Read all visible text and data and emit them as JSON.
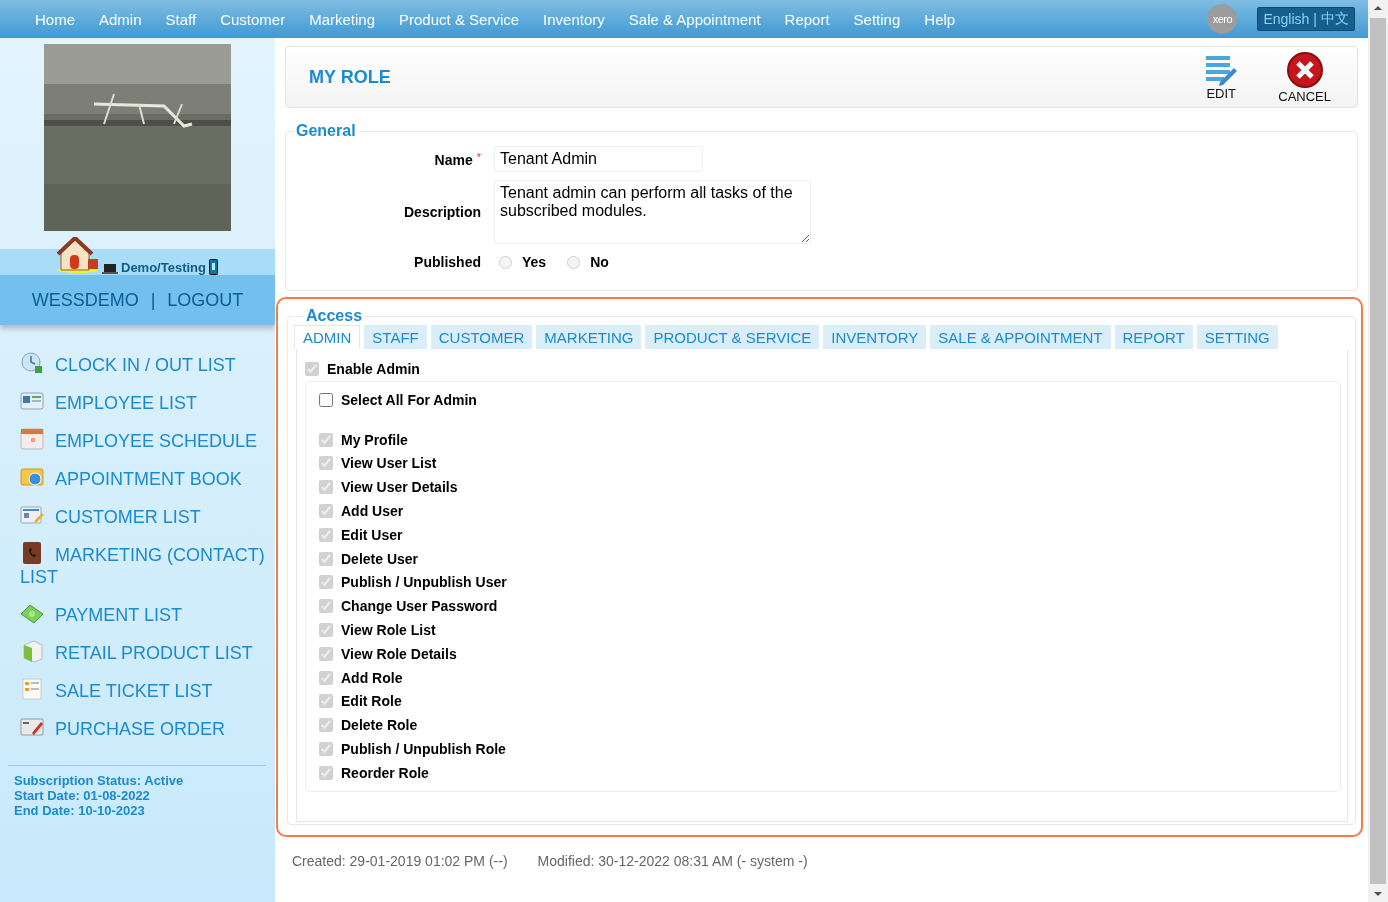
{
  "nav": {
    "items": [
      "Home",
      "Admin",
      "Staff",
      "Customer",
      "Marketing",
      "Product & Service",
      "Inventory",
      "Sale & Appointment",
      "Report",
      "Setting",
      "Help"
    ],
    "logo": "xero",
    "language": {
      "items": [
        "English",
        "中文"
      ],
      "separator": "|"
    }
  },
  "sidebar": {
    "site": "Demo/Testing",
    "user": "WESSDEMO",
    "separator": "|",
    "logout": "LOGOUT",
    "menu": [
      {
        "label": "CLOCK IN / OUT LIST"
      },
      {
        "label": "EMPLOYEE LIST"
      },
      {
        "label": "EMPLOYEE SCHEDULE"
      },
      {
        "label": "APPOINTMENT BOOK"
      },
      {
        "label": "CUSTOMER LIST"
      },
      {
        "label": "MARKETING (CONTACT) LIST"
      },
      {
        "label": "PAYMENT LIST"
      },
      {
        "label": "RETAIL PRODUCT LIST"
      },
      {
        "label": "SALE TICKET LIST"
      },
      {
        "label": "PURCHASE ORDER"
      }
    ],
    "subscription": [
      "Subscription Status: Active",
      "Start Date: 01-08-2022",
      "End Date: 10-10-2023"
    ]
  },
  "header": {
    "title": "MY ROLE",
    "actions": [
      {
        "kind": "edit",
        "label": "EDIT"
      },
      {
        "kind": "cancel",
        "label": "CANCEL"
      }
    ]
  },
  "general": {
    "legend": "General",
    "name": {
      "label": "Name",
      "required": true,
      "required_mark": "*",
      "value": "Tenant Admin"
    },
    "description": {
      "label": "Description",
      "value": "Tenant admin can perform all tasks of the subscribed modules."
    },
    "published": {
      "label": "Published",
      "options": [
        {
          "label": "Yes",
          "selected": false,
          "disabled": true
        },
        {
          "label": "No",
          "selected": false,
          "disabled": true
        }
      ]
    }
  },
  "access": {
    "legend": "Access",
    "highlighted": true,
    "tabs": [
      {
        "label": "ADMIN",
        "selected": true
      },
      {
        "label": "STAFF",
        "selected": false
      },
      {
        "label": "CUSTOMER",
        "selected": false
      },
      {
        "label": "MARKETING",
        "selected": false
      },
      {
        "label": "PRODUCT & SERVICE",
        "selected": false
      },
      {
        "label": "INVENTORY",
        "selected": false
      },
      {
        "label": "SALE & APPOINTMENT",
        "selected": false
      },
      {
        "label": "REPORT",
        "selected": false
      },
      {
        "label": "SETTING",
        "selected": false
      }
    ],
    "enable": {
      "label": "Enable Admin",
      "checked": true,
      "disabled": true
    },
    "select_all": {
      "label": "Select All For Admin",
      "checked": false,
      "disabled": false
    },
    "permissions": [
      {
        "label": "My Profile",
        "checked": true,
        "disabled": true
      },
      {
        "label": "View User List",
        "checked": true,
        "disabled": true
      },
      {
        "label": "View User Details",
        "checked": true,
        "disabled": true
      },
      {
        "label": "Add User",
        "checked": true,
        "disabled": true
      },
      {
        "label": "Edit User",
        "checked": true,
        "disabled": true
      },
      {
        "label": "Delete User",
        "checked": true,
        "disabled": true
      },
      {
        "label": "Publish / Unpublish User",
        "checked": true,
        "disabled": true
      },
      {
        "label": "Change User Password",
        "checked": true,
        "disabled": true
      },
      {
        "label": "View Role List",
        "checked": true,
        "disabled": true
      },
      {
        "label": "View Role Details",
        "checked": true,
        "disabled": true
      },
      {
        "label": "Add Role",
        "checked": true,
        "disabled": true
      },
      {
        "label": "Edit Role",
        "checked": true,
        "disabled": true
      },
      {
        "label": "Delete Role",
        "checked": true,
        "disabled": true
      },
      {
        "label": "Publish / Unpublish Role",
        "checked": true,
        "disabled": true
      },
      {
        "label": "Reorder Role",
        "checked": true,
        "disabled": true
      }
    ]
  },
  "footer": {
    "created": "Created: 29-01-2019 01:02 PM (--)",
    "modified": "Modified: 30-12-2022 08:31 AM (- system -)"
  }
}
